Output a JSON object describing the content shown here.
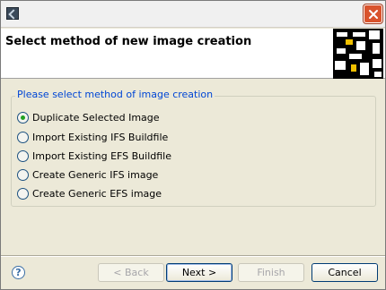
{
  "window": {
    "title": ""
  },
  "banner": {
    "title": "Select method of new image creation"
  },
  "group": {
    "legend": "Please select method of image creation",
    "options": [
      {
        "label": "Duplicate Selected Image",
        "checked": true
      },
      {
        "label": "Import Existing IFS Buildfile",
        "checked": false
      },
      {
        "label": "Import Existing EFS Buildfile",
        "checked": false
      },
      {
        "label": "Create Generic IFS image",
        "checked": false
      },
      {
        "label": "Create Generic EFS image",
        "checked": false
      }
    ]
  },
  "buttons": {
    "back": "< Back",
    "next": "Next >",
    "finish": "Finish",
    "cancel": "Cancel"
  },
  "help": {
    "glyph": "?"
  },
  "icons": {
    "app": "app-icon",
    "close": "close-icon",
    "help": "help-icon",
    "banner": "banner-image"
  }
}
